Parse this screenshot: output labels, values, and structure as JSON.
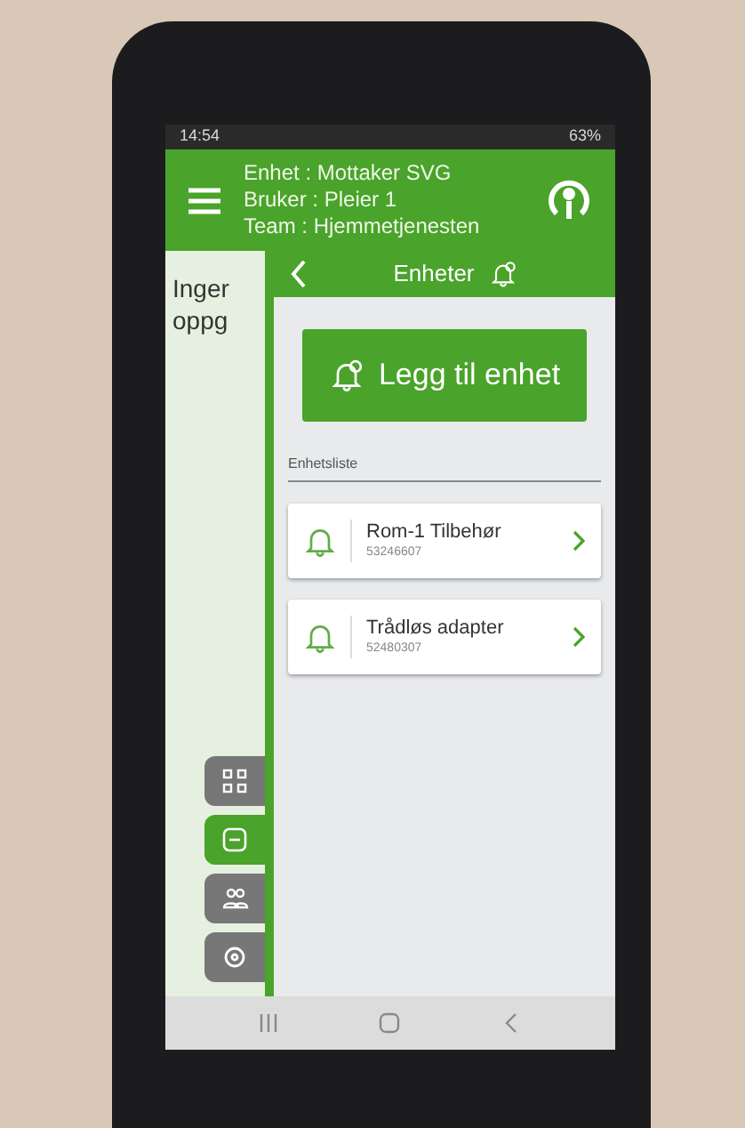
{
  "status_bar": {
    "time": "14:54",
    "battery": "63%"
  },
  "header": {
    "lines": [
      "Enhet : Mottaker SVG",
      "Bruker : Pleier 1",
      "Team : Hjemmetjenesten"
    ]
  },
  "background_text": "Inger oppg",
  "side_rail": [
    {
      "kind": "scan",
      "selected": false
    },
    {
      "kind": "device",
      "selected": true
    },
    {
      "kind": "people",
      "selected": false
    },
    {
      "kind": "settings",
      "selected": false
    }
  ],
  "panel": {
    "title": "Enheter",
    "add_button": "Legg til enhet",
    "list_label": "Enhetsliste",
    "devices": [
      {
        "name": "Rom-1 Tilbehør",
        "id": "53246607"
      },
      {
        "name": "Trådløs adapter",
        "id": "52480307"
      }
    ]
  }
}
